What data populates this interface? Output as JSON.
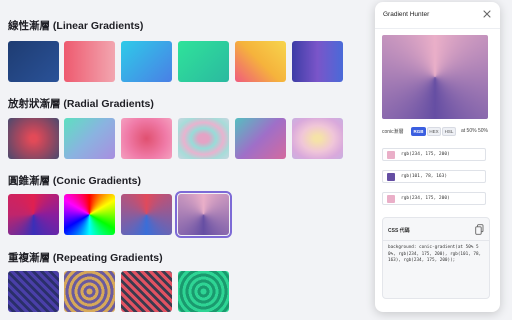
{
  "sections": [
    {
      "title": "線性漸層 (Linear Gradients)"
    },
    {
      "title": "放射狀漸層 (Radial Gradients)"
    },
    {
      "title": "圓錐漸層 (Conic Gradients)"
    },
    {
      "title": "重複漸層 (Repeating Gradients)"
    }
  ],
  "panel": {
    "title": "Gradient Hunter",
    "close_icon": "close-icon",
    "mode_label": "conic漸層",
    "formats": [
      "RGB",
      "HEX",
      "HSL"
    ],
    "active_format": "RGB",
    "position": "at 50% 50%",
    "stops": [
      {
        "color": "#eaafc8",
        "value": "rgb(234, 175, 200)"
      },
      {
        "color": "#654ea3",
        "value": "rgb(101, 78, 163)"
      },
      {
        "color": "#eaafc8",
        "value": "rgb(234, 175, 200)"
      }
    ],
    "css_label": "CSS 代碼",
    "copy_icon": "copy-icon",
    "css_code": "background: conic-gradient(at 50% 50%, rgb(234, 175, 200), rgb(101, 78, 163), rgb(234, 175, 200));"
  },
  "accent_color": "#3b5fe0",
  "selected_swatch": "conic-4"
}
